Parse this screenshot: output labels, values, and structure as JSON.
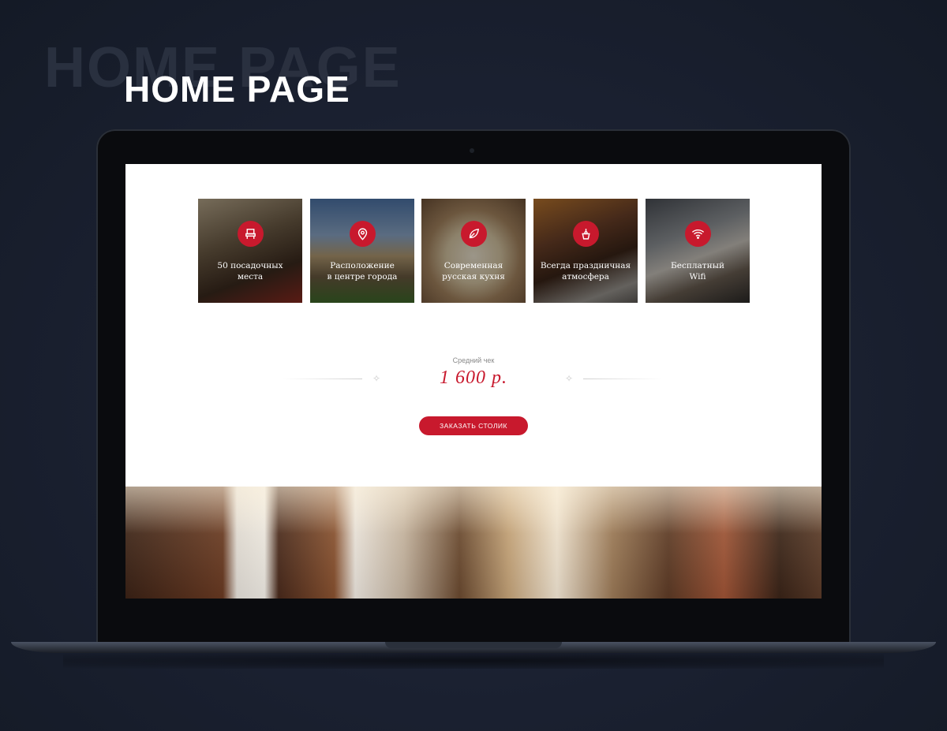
{
  "page": {
    "title": "HOME PAGE"
  },
  "colors": {
    "accent": "#c8192d",
    "background": "#1a2030",
    "screen": "#ffffff"
  },
  "features": [
    {
      "label": "50 посадочных\nместа",
      "icon": "chair-icon",
      "bg": "linear-gradient(160deg, #b6a68a 0%, #6b5a44 40%, #3b2a1e 70%, #8a2a20 100%)"
    },
    {
      "label": "Расположение\nв центре города",
      "icon": "location-pin-icon",
      "bg": "linear-gradient(180deg, #4d74a8 0%, #8ba6c6 35%, #b29a72 55%, #6a5a40 75%, #3f6a2a 100%)"
    },
    {
      "label": "Современная\nрусская кухня",
      "icon": "leaf-icon",
      "bg": "radial-gradient(circle at 50% 55%, #efe6d2 0%, #d8c7a4 35%, #a68560 60%, #6c4f35 100%)"
    },
    {
      "label": "Всегда праздничная\nатмосфера",
      "icon": "champagne-bucket-icon",
      "bg": "linear-gradient(160deg, #b8742e 0%, #6b4028 35%, #3a2418 60%, #9a9690 85%, #5e5a56 100%)"
    },
    {
      "label": "Бесплатный\nWifi",
      "icon": "wifi-icon",
      "bg": "linear-gradient(160deg, #4a4e55 0%, #8e9296 35%, #c9c4bc 55%, #6a5e52 75%, #2c2a28 100%)"
    }
  ],
  "average_check": {
    "label": "Средний чек",
    "value": "1 600 р."
  },
  "cta": {
    "label": "ЗАКАЗАТЬ СТОЛИК"
  }
}
